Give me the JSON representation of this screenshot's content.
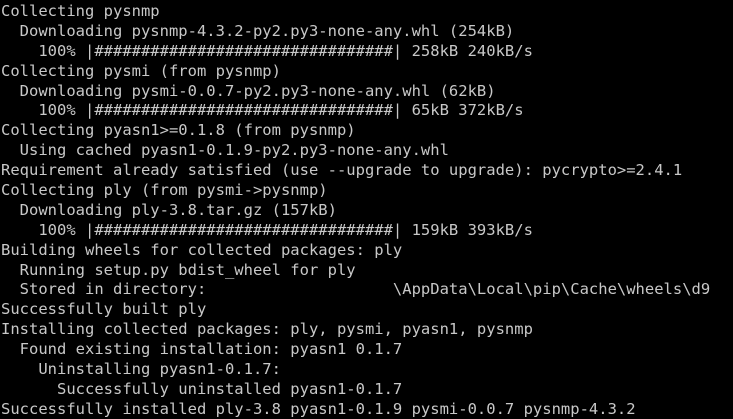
{
  "terminal": {
    "background": "#000000",
    "foreground": "#c8c8c8",
    "lines": [
      "Collecting pysnmp",
      "  Downloading pysnmp-4.3.2-py2.py3-none-any.whl (254kB)",
      "    100% |################################| 258kB 240kB/s",
      "Collecting pysmi (from pysnmp)",
      "  Downloading pysmi-0.0.7-py2.py3-none-any.whl (62kB)",
      "    100% |################################| 65kB 372kB/s",
      "Collecting pyasn1>=0.1.8 (from pysnmp)",
      "  Using cached pyasn1-0.1.9-py2.py3-none-any.whl",
      "Requirement already satisfied (use --upgrade to upgrade): pycrypto>=2.4.1",
      "Collecting ply (from pysmi->pysnmp)",
      "  Downloading ply-3.8.tar.gz (157kB)",
      "    100% |################################| 159kB 393kB/s",
      "Building wheels for collected packages: ply",
      "  Running setup.py bdist_wheel for ply",
      "  Stored in directory:                    \\AppData\\Local\\pip\\Cache\\wheels\\d9",
      "Successfully built ply",
      "Installing collected packages: ply, pysmi, pyasn1, pysnmp",
      "  Found existing installation: pyasn1 0.1.7",
      "    Uninstalling pyasn1-0.1.7:",
      "      Successfully uninstalled pyasn1-0.1.7",
      "Successfully installed ply-3.8 pyasn1-0.1.9 pysmi-0.0.7 pysnmp-4.3.2"
    ]
  }
}
